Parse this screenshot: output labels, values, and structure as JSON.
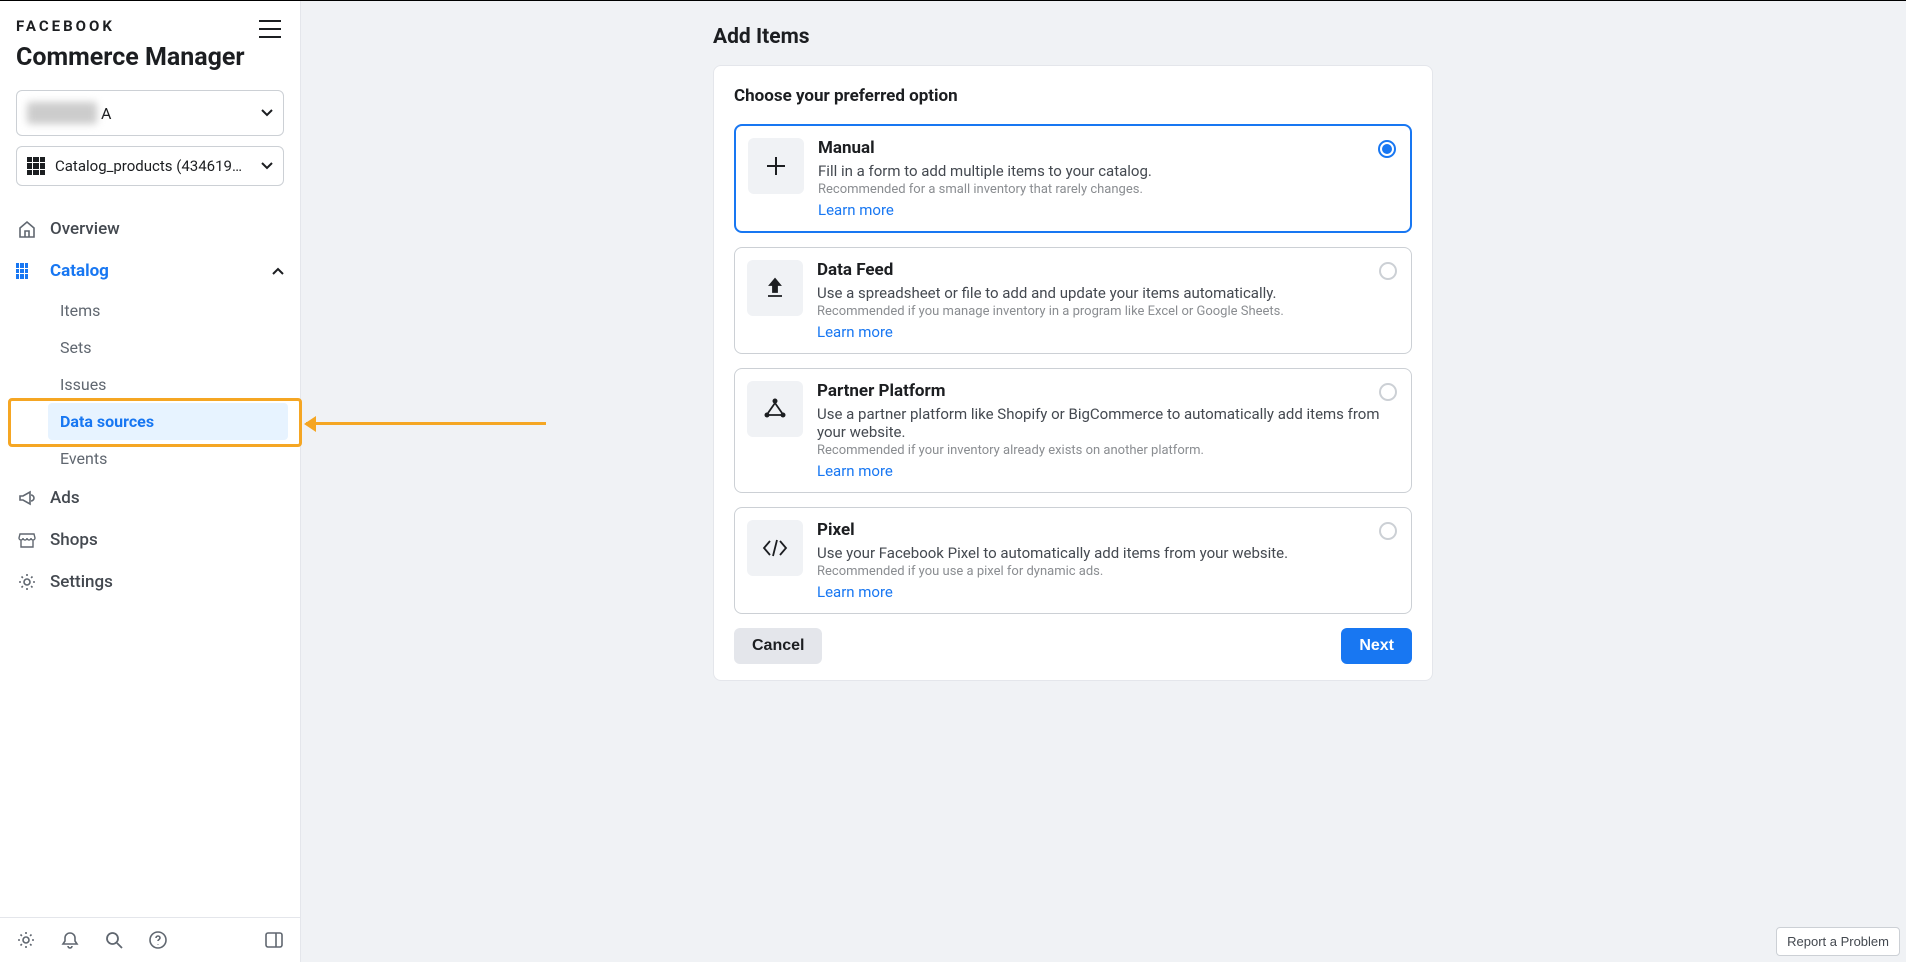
{
  "brand": "FACEBOOK",
  "app_title": "Commerce Manager",
  "account_selector_suffix": "A",
  "catalog_selector_text": "Catalog_products (43461994...",
  "sidebar": {
    "overview": "Overview",
    "catalog": "Catalog",
    "catalog_sub": {
      "items": "Items",
      "sets": "Sets",
      "issues": "Issues",
      "data_sources": "Data sources",
      "events": "Events"
    },
    "ads": "Ads",
    "shops": "Shops",
    "settings": "Settings"
  },
  "main": {
    "page_title": "Add Items",
    "prompt": "Choose your preferred option",
    "options": [
      {
        "title": "Manual",
        "desc": "Fill in a form to add multiple items to your catalog.",
        "rec": "Recommended for a small inventory that rarely changes.",
        "learn": "Learn more"
      },
      {
        "title": "Data Feed",
        "desc": "Use a spreadsheet or file to add and update your items automatically.",
        "rec": "Recommended if you manage inventory in a program like Excel or Google Sheets.",
        "learn": "Learn more"
      },
      {
        "title": "Partner Platform",
        "desc": "Use a partner platform like Shopify or BigCommerce to automatically add items from your website.",
        "rec": "Recommended if your inventory already exists on another platform.",
        "learn": "Learn more"
      },
      {
        "title": "Pixel",
        "desc": "Use your Facebook Pixel to automatically add items from your website.",
        "rec": "Recommended if you use a pixel for dynamic ads.",
        "learn": "Learn more"
      }
    ],
    "cancel": "Cancel",
    "next": "Next"
  },
  "report_problem": "Report a Problem"
}
